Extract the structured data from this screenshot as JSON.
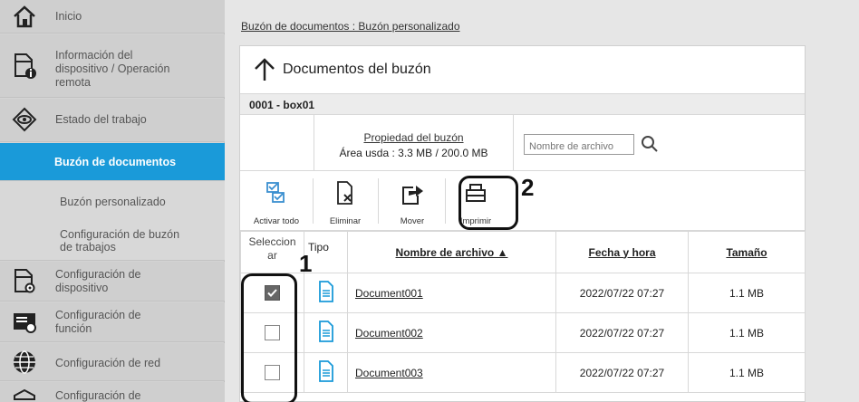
{
  "sidebar": {
    "items": [
      {
        "label": "Inicio"
      },
      {
        "label_lines": [
          "Información del",
          "dispositivo / Operación",
          "remota"
        ]
      },
      {
        "label": "Estado del trabajo"
      },
      {
        "label": "Buzón de documentos"
      },
      {
        "label": "Buzón personalizado"
      },
      {
        "label_lines": [
          "Configuración de buzón",
          "de trabajos"
        ]
      },
      {
        "label_lines": [
          "Configuración de",
          "dispositivo"
        ]
      },
      {
        "label_lines": [
          "Configuración de",
          "función"
        ]
      },
      {
        "label": "Configuración de red"
      },
      {
        "label": "Configuración de"
      }
    ]
  },
  "breadcrumb": "Buzón de documentos : Buzón personalizado",
  "panel": {
    "title": "Documentos del buzón",
    "box_id": "0001 - box01",
    "property_link": "Propiedad del buzón",
    "usage": "Área usda : 3.3 MB / 200.0 MB",
    "search_placeholder": "Nombre de archivo"
  },
  "toolbar": {
    "select_all": "Activar todo",
    "delete": "Eliminar",
    "move": "Mover",
    "print": "Imprimir"
  },
  "table": {
    "headers": {
      "select_lines": [
        "Seleccion",
        "ar"
      ],
      "type": "Tipo",
      "filename": "Nombre de archivo ▲",
      "datetime": "Fecha y hora",
      "size": "Tamaño"
    },
    "rows": [
      {
        "checked": true,
        "name": "Document001",
        "datetime": "2022/07/22 07:27",
        "size": "1.1 MB"
      },
      {
        "checked": false,
        "name": "Document002",
        "datetime": "2022/07/22 07:27",
        "size": "1.1 MB"
      },
      {
        "checked": false,
        "name": "Document003",
        "datetime": "2022/07/22 07:27",
        "size": "1.1 MB"
      }
    ]
  },
  "annotations": {
    "one": "1",
    "two": "2"
  },
  "colors": {
    "accent": "#1a9ad9",
    "doc_icon": "#1a9ad9"
  }
}
